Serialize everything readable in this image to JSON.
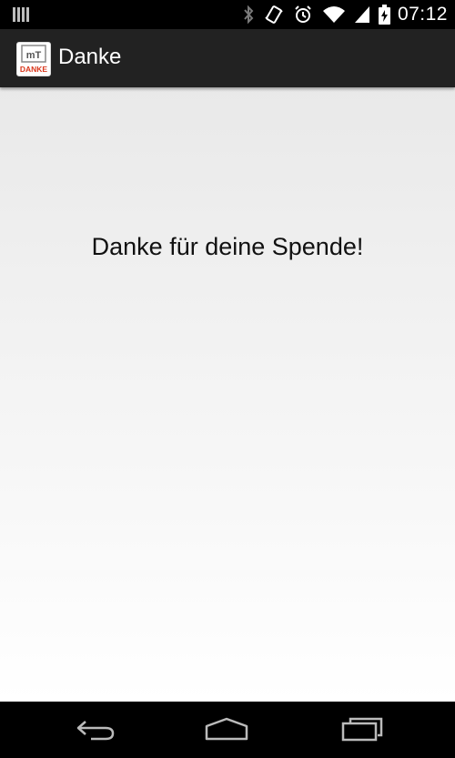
{
  "status_bar": {
    "time": "07:12",
    "icons": [
      "notification-icon",
      "bluetooth-icon",
      "vibrate-icon",
      "alarm-icon",
      "wifi-icon",
      "signal-icon",
      "battery-charging-icon"
    ]
  },
  "action_bar": {
    "title": "Danke",
    "app_icon": {
      "name": "app-logo-icon",
      "logo_text": "mT",
      "caption": "DANKE",
      "caption_color": "#d9361b"
    }
  },
  "main": {
    "message": "Danke für deine Spende!"
  },
  "nav_bar": {
    "buttons": [
      "back-icon",
      "home-icon",
      "recents-icon"
    ]
  },
  "colors": {
    "status_bar_bg": "#000000",
    "action_bar_bg": "#222222",
    "content_gradient_top": "#e9e9e9",
    "content_gradient_bottom": "#ffffff",
    "nav_bar_bg": "#000000"
  }
}
